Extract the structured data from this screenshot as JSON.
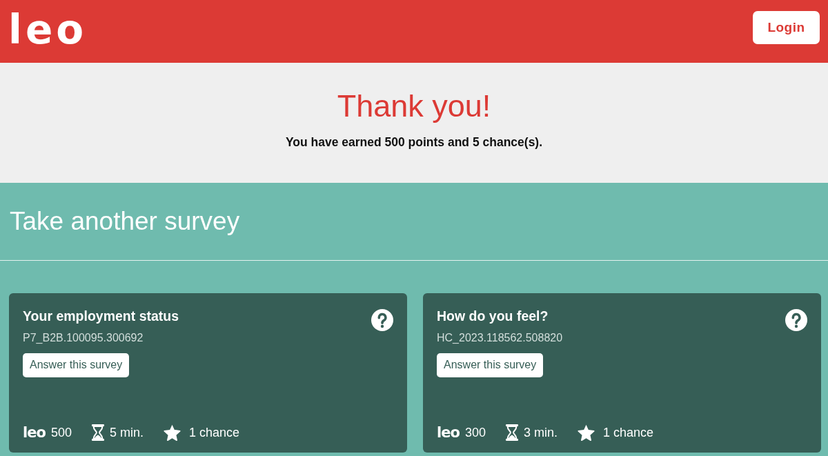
{
  "header": {
    "logo": "leo",
    "login_button": "Login"
  },
  "thank_you": {
    "title": "Thank you!",
    "message": "You have earned 500 points and 5 chance(s)."
  },
  "section": {
    "title": "Take another survey"
  },
  "surveys": [
    {
      "title": "Your employment status",
      "code": "P7_B2B.100095.300692",
      "button": "Answer this survey",
      "points_logo": "leo",
      "points": "500",
      "duration": "5 min.",
      "chances": "1 chance"
    },
    {
      "title": "How do you feel?",
      "code": "HC_2023.118562.508820",
      "button": "Answer this survey",
      "points_logo": "leo",
      "points": "300",
      "duration": "3 min.",
      "chances": "1 chance"
    }
  ]
}
